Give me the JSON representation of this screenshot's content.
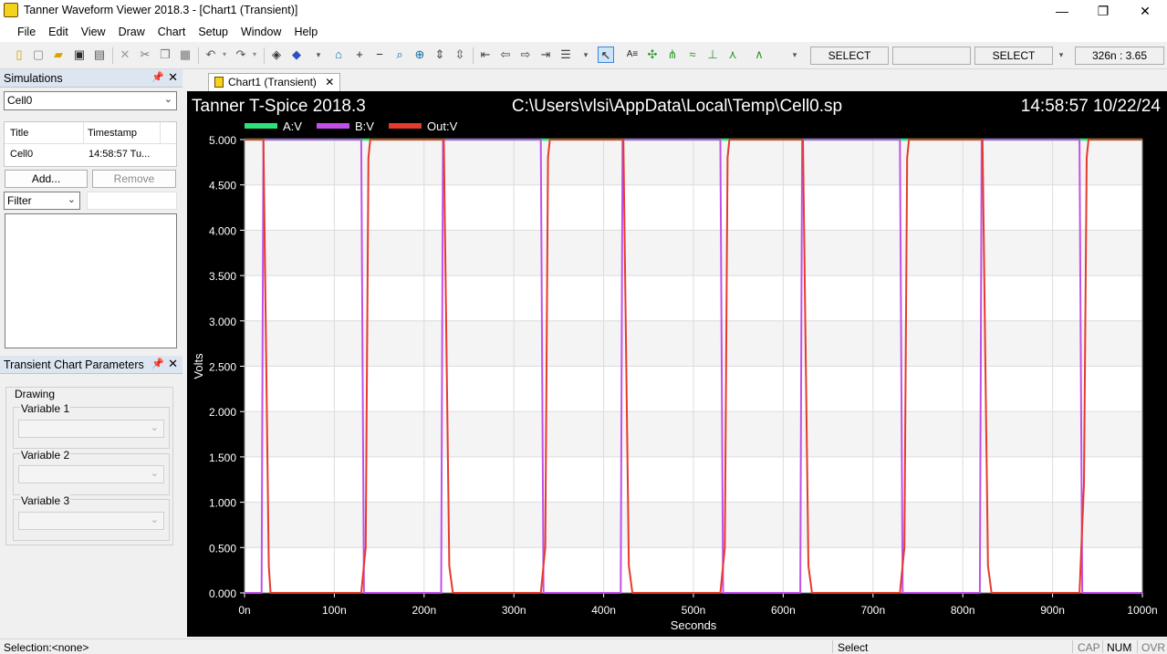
{
  "window": {
    "title": "Tanner Waveform Viewer 2018.3 - [Chart1 (Transient)]",
    "minimize": "—",
    "restore": "❐",
    "close": "✕"
  },
  "menu": [
    "File",
    "Edit",
    "View",
    "Draw",
    "Chart",
    "Setup",
    "Window",
    "Help"
  ],
  "toolbar": {
    "select1": "SELECT",
    "select2": "SELECT",
    "cursor_readout": "326n : 3.65"
  },
  "simulations_panel": {
    "title": "Simulations",
    "selected": "Cell0",
    "columns": [
      "Title",
      "Timestamp"
    ],
    "rows": [
      {
        "title": "Cell0",
        "timestamp": "14:58:57 Tu..."
      }
    ],
    "add_label": "Add...",
    "remove_label": "Remove",
    "filter_label": "Filter",
    "filter_value": ""
  },
  "params_panel": {
    "title": "Transient Chart Parameters",
    "group_label": "Drawing",
    "var1": "Variable 1",
    "var2": "Variable 2",
    "var3": "Variable 3"
  },
  "tab": {
    "label": "Chart1 (Transient)",
    "close": "✕"
  },
  "status": {
    "selection": "Selection:<none>",
    "mode": "Select",
    "cap": "CAP",
    "num": "NUM",
    "ovr": "OVR"
  },
  "chart_header": {
    "left": "Tanner T-Spice 2018.3",
    "center": "C:\\Users\\vlsi\\AppData\\Local\\Temp\\Cell0.sp",
    "right": "14:58:57 10/22/24"
  },
  "chart_data": {
    "type": "line",
    "xlabel": "Seconds",
    "ylabel": "Volts",
    "xlim": [
      0,
      1000
    ],
    "ylim": [
      0,
      5
    ],
    "x_unit_suffix": "n",
    "xticks": [
      "0n",
      "100n",
      "200n",
      "300n",
      "400n",
      "500n",
      "600n",
      "700n",
      "800n",
      "900n",
      "1000n"
    ],
    "yticks": [
      "0.000",
      "0.500",
      "1.000",
      "1.500",
      "2.000",
      "2.500",
      "3.000",
      "3.500",
      "4.000",
      "4.500",
      "5.000"
    ],
    "grid": true,
    "legend_placement": "top-left",
    "series": [
      {
        "name": "A:V",
        "color": "#2ee07a",
        "x": [
          0,
          19,
          21,
          29,
          31,
          1000
        ],
        "y": [
          5,
          5,
          5,
          5,
          5,
          5
        ]
      },
      {
        "name": "B:V",
        "color": "#c050e8",
        "x": [
          0,
          19,
          21,
          29,
          31,
          128,
          130,
          133,
          135,
          219,
          221,
          229,
          231,
          328,
          330,
          333,
          335,
          419,
          421,
          429,
          431,
          528,
          530,
          533,
          535,
          619,
          621,
          629,
          631,
          728,
          730,
          733,
          735,
          819,
          821,
          829,
          831,
          928,
          930,
          933,
          935,
          1000
        ],
        "y": [
          0,
          0,
          5,
          5,
          5,
          5,
          5,
          0,
          0,
          0,
          5,
          5,
          5,
          5,
          5,
          0,
          0,
          0,
          5,
          5,
          5,
          5,
          5,
          0,
          0,
          0,
          5,
          5,
          5,
          5,
          5,
          0,
          0,
          0,
          5,
          5,
          5,
          5,
          5,
          0,
          0,
          0
        ]
      },
      {
        "name": "Out:V",
        "color": "#e53a2c",
        "x": [
          0,
          20,
          21,
          27,
          29,
          33,
          130,
          135,
          138,
          140,
          220,
          222,
          228,
          232,
          330,
          335,
          338,
          340,
          420,
          422,
          428,
          432,
          530,
          535,
          538,
          540,
          620,
          622,
          628,
          632,
          730,
          735,
          738,
          740,
          820,
          822,
          828,
          832,
          930,
          935,
          938,
          940,
          1000
        ],
        "y": [
          5,
          5,
          5,
          0.3,
          0,
          0,
          0,
          0.5,
          4.8,
          5,
          5,
          5,
          0.3,
          0,
          0,
          0.5,
          4.8,
          5,
          5,
          5,
          0.3,
          0,
          0,
          0.5,
          4.8,
          5,
          5,
          5,
          0.3,
          0,
          0,
          0.5,
          4.8,
          5,
          5,
          5,
          0.3,
          0,
          0,
          1.2,
          4.8,
          5,
          5
        ]
      }
    ]
  }
}
